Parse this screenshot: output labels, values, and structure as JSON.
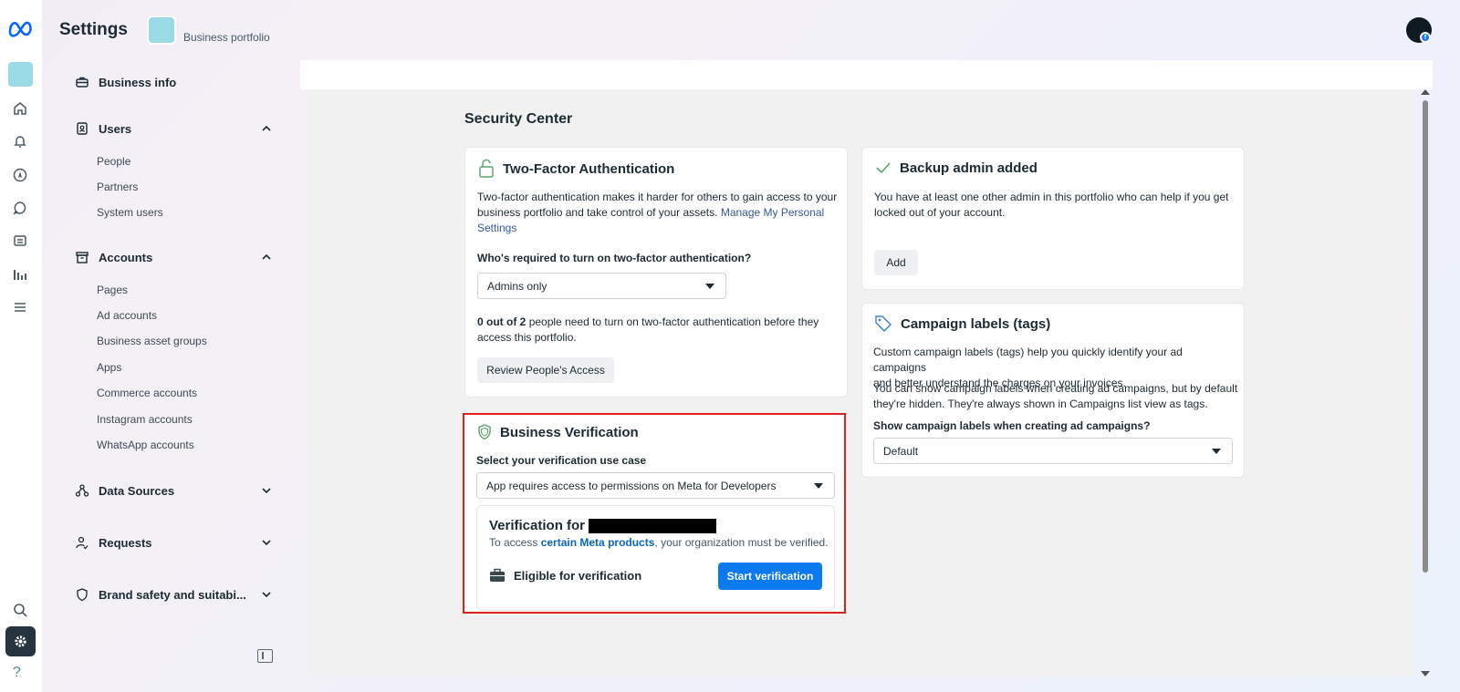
{
  "header": {
    "title": "Settings",
    "portfolio_label": "Business portfolio"
  },
  "sidebar": {
    "business_info": "Business info",
    "users": {
      "label": "Users",
      "items": [
        "People",
        "Partners",
        "System users"
      ]
    },
    "accounts": {
      "label": "Accounts",
      "items": [
        "Pages",
        "Ad accounts",
        "Business asset groups",
        "Apps",
        "Commerce accounts",
        "Instagram accounts",
        "WhatsApp accounts"
      ]
    },
    "data_sources": "Data Sources",
    "requests": "Requests",
    "brand_safety": "Brand safety and suitabi..."
  },
  "main": {
    "page_title": "Security Center",
    "two_factor": {
      "title": "Two-Factor Authentication",
      "desc_1": "Two-factor authentication makes it harder for others to gain access to your",
      "desc_2": "business portfolio and take control of your assets.",
      "link_1": "Manage My Personal",
      "link_2": "Settings",
      "question": "Who's required to turn on two-factor authentication?",
      "select_value": "Admins only",
      "count_bold": "0 out of 2",
      "count_rest_1": "people need to turn on two-factor authentication before they",
      "count_rest_2": "access this portfolio.",
      "review_button": "Review People's Access"
    },
    "backup_admin": {
      "title": "Backup admin added",
      "desc_1": "You have at least one other admin in this portfolio who can help if you get",
      "desc_2": "locked out of your account.",
      "add_button": "Add"
    },
    "campaign_labels": {
      "title": "Campaign labels (tags)",
      "desc_1": "Custom campaign labels (tags) help you quickly identify your ad campaigns",
      "desc_2": "and better understand the charges on your invoices.",
      "desc_3": "You can show campaign labels when creating ad campaigns, but by default",
      "desc_4": "they're hidden. They're always shown in Campaigns list view as tags.",
      "question": "Show campaign labels when creating ad campaigns?",
      "select_value": "Default"
    },
    "business_verification": {
      "title": "Business Verification",
      "use_case_label": "Select your verification use case",
      "select_value": "App requires access to permissions on Meta for Developers",
      "verification_for": "Verification for",
      "access_prefix": "To access",
      "access_link": "certain Meta products",
      "access_suffix": ", your organization must be verified.",
      "eligible": "Eligible for verification",
      "start_button": "Start verification"
    }
  },
  "help_glyph": "?",
  "colors": {
    "accent_blue": "#0b7af0",
    "highlight_red": "#e02020",
    "shield_green": "#5aa469"
  }
}
